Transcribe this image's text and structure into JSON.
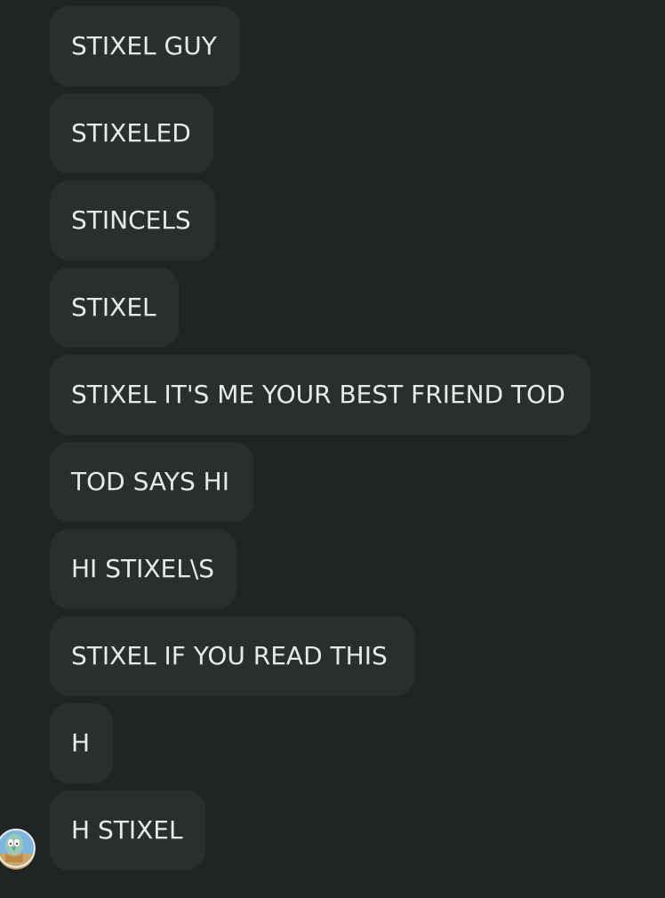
{
  "messages": [
    {
      "text": "STIXEL GUY"
    },
    {
      "text": "STIXELED"
    },
    {
      "text": "STINCELS"
    },
    {
      "text": "STIXEL"
    },
    {
      "text": "STIXEL IT'S ME YOUR BEST FRIEND TOD"
    },
    {
      "text": "TOD SAYS HI"
    },
    {
      "text": "HI STIXEL\\S"
    },
    {
      "text": "STIXEL IF YOU READ THIS"
    },
    {
      "text": "H"
    },
    {
      "text": "H STIXEL"
    }
  ],
  "avatar": {
    "icon": "squidward-avatar-icon"
  },
  "colors": {
    "background": "#212424",
    "bubble": "#2b2e2f",
    "text": "#e8eaea"
  }
}
